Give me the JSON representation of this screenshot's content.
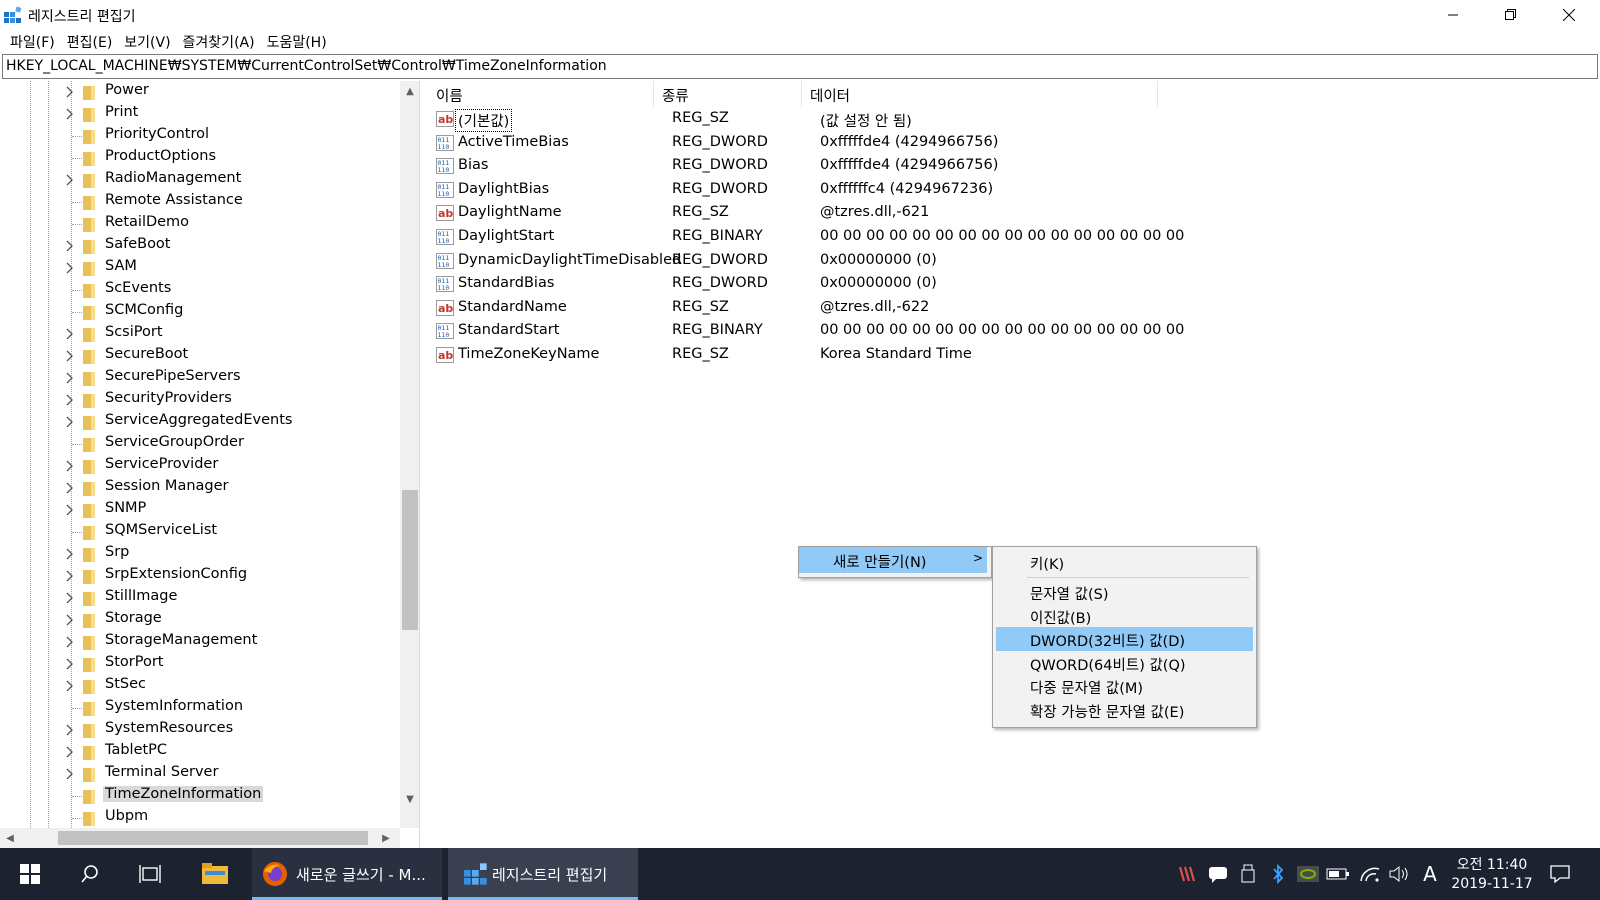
{
  "window": {
    "title": "레지스트리 편집기"
  },
  "menu": [
    "파일(F)",
    "편집(E)",
    "보기(V)",
    "즐겨찾기(A)",
    "도움말(H)"
  ],
  "address": "HKEY_LOCAL_MACHINE₩SYSTEM₩CurrentControlSet₩Control₩TimeZoneInformation",
  "tree": {
    "items": [
      {
        "label": "Power",
        "expandable": true
      },
      {
        "label": "Print",
        "expandable": true
      },
      {
        "label": "PriorityControl",
        "expandable": false
      },
      {
        "label": "ProductOptions",
        "expandable": false
      },
      {
        "label": "RadioManagement",
        "expandable": true
      },
      {
        "label": "Remote Assistance",
        "expandable": false
      },
      {
        "label": "RetailDemo",
        "expandable": false
      },
      {
        "label": "SafeBoot",
        "expandable": true
      },
      {
        "label": "SAM",
        "expandable": true
      },
      {
        "label": "ScEvents",
        "expandable": false
      },
      {
        "label": "SCMConfig",
        "expandable": false
      },
      {
        "label": "ScsiPort",
        "expandable": true
      },
      {
        "label": "SecureBoot",
        "expandable": true
      },
      {
        "label": "SecurePipeServers",
        "expandable": true
      },
      {
        "label": "SecurityProviders",
        "expandable": true
      },
      {
        "label": "ServiceAggregatedEvents",
        "expandable": true
      },
      {
        "label": "ServiceGroupOrder",
        "expandable": false
      },
      {
        "label": "ServiceProvider",
        "expandable": true
      },
      {
        "label": "Session Manager",
        "expandable": true
      },
      {
        "label": "SNMP",
        "expandable": true
      },
      {
        "label": "SQMServiceList",
        "expandable": false
      },
      {
        "label": "Srp",
        "expandable": true
      },
      {
        "label": "SrpExtensionConfig",
        "expandable": true
      },
      {
        "label": "StillImage",
        "expandable": true
      },
      {
        "label": "Storage",
        "expandable": true
      },
      {
        "label": "StorageManagement",
        "expandable": true
      },
      {
        "label": "StorPort",
        "expandable": true
      },
      {
        "label": "StSec",
        "expandable": true
      },
      {
        "label": "SystemInformation",
        "expandable": false
      },
      {
        "label": "SystemResources",
        "expandable": true
      },
      {
        "label": "TabletPC",
        "expandable": true
      },
      {
        "label": "Terminal Server",
        "expandable": true
      },
      {
        "label": "TimeZoneInformation",
        "expandable": false,
        "selected": true
      },
      {
        "label": "Ubpm",
        "expandable": false
      }
    ]
  },
  "list": {
    "columns": [
      "이름",
      "종류",
      "데이터"
    ],
    "rows": [
      {
        "icon": "string-value-icon",
        "name": "(기본값)",
        "type": "REG_SZ",
        "data": "(값 설정 안 됨)"
      },
      {
        "icon": "binary-value-icon",
        "name": "ActiveTimeBias",
        "type": "REG_DWORD",
        "data": "0xfffffde4 (4294966756)"
      },
      {
        "icon": "binary-value-icon",
        "name": "Bias",
        "type": "REG_DWORD",
        "data": "0xfffffde4 (4294966756)"
      },
      {
        "icon": "binary-value-icon",
        "name": "DaylightBias",
        "type": "REG_DWORD",
        "data": "0xffffffc4 (4294967236)"
      },
      {
        "icon": "string-value-icon",
        "name": "DaylightName",
        "type": "REG_SZ",
        "data": "@tzres.dll,-621"
      },
      {
        "icon": "binary-value-icon",
        "name": "DaylightStart",
        "type": "REG_BINARY",
        "data": "00 00 00 00 00 00 00 00 00 00 00 00 00 00 00 00"
      },
      {
        "icon": "binary-value-icon",
        "name": "DynamicDaylightTimeDisabled",
        "type": "REG_DWORD",
        "data": "0x00000000 (0)"
      },
      {
        "icon": "binary-value-icon",
        "name": "StandardBias",
        "type": "REG_DWORD",
        "data": "0x00000000 (0)"
      },
      {
        "icon": "string-value-icon",
        "name": "StandardName",
        "type": "REG_SZ",
        "data": "@tzres.dll,-622"
      },
      {
        "icon": "binary-value-icon",
        "name": "StandardStart",
        "type": "REG_BINARY",
        "data": "00 00 00 00 00 00 00 00 00 00 00 00 00 00 00 00"
      },
      {
        "icon": "string-value-icon",
        "name": "TimeZoneKeyName",
        "type": "REG_SZ",
        "data": "Korea Standard Time"
      }
    ]
  },
  "context_menu": {
    "new_label": "새로 만들기(N)",
    "submenu": {
      "key": "키(K)",
      "items": [
        "문자열 값(S)",
        "이진값(B)",
        "DWORD(32비트) 값(D)",
        "QWORD(64비트) 값(Q)",
        "다중 문자열 값(M)",
        "확장 가능한 문자열 값(E)"
      ],
      "highlighted": "DWORD(32비트) 값(D)"
    }
  },
  "taskbar": {
    "apps": [
      {
        "label": "새로운 글쓰기 - M...",
        "icon": "firefox-icon"
      },
      {
        "label": "레지스트리 편집기",
        "icon": "regedit-icon",
        "active": true
      }
    ],
    "ime": "A",
    "time": "오전 11:40",
    "date": "2019-11-17"
  },
  "colors": {
    "highlight": "#91c9f7",
    "taskbar": "#1c2230",
    "folder": "#e8c15a"
  }
}
